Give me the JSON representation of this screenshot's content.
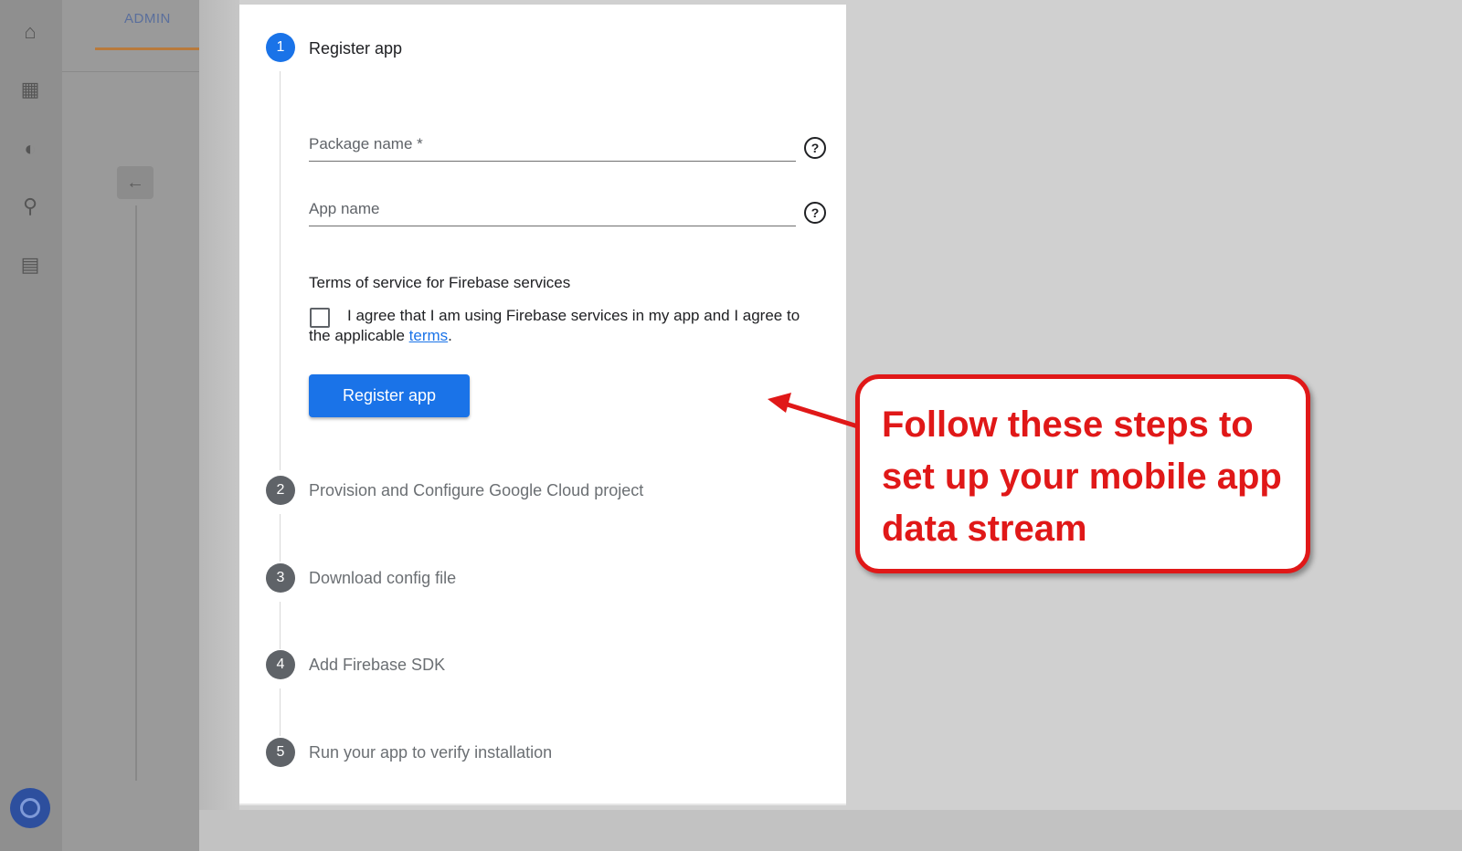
{
  "background_app": {
    "admin_tab_label": "ADMIN"
  },
  "steps": [
    {
      "number": "1",
      "title": "Register app",
      "state": "active"
    },
    {
      "number": "2",
      "title": "Provision and Configure Google Cloud project",
      "state": "inactive"
    },
    {
      "number": "3",
      "title": "Download config file",
      "state": "inactive"
    },
    {
      "number": "4",
      "title": "Add Firebase SDK",
      "state": "inactive"
    },
    {
      "number": "5",
      "title": "Run your app to verify installation",
      "state": "inactive"
    }
  ],
  "form": {
    "package_name_placeholder": "Package name *",
    "package_name_value": "",
    "app_name_placeholder": "App name",
    "app_name_value": "",
    "help_icon_glyph": "?",
    "terms_heading": "Terms of service for Firebase services",
    "agree_text_before": "I agree that I am using Firebase services in my app and I agree to the applicable ",
    "agree_link": "terms",
    "agree_text_after": ".",
    "checkbox_checked": false,
    "register_button_label": "Register app"
  },
  "annotation": {
    "callout_text": "Follow these steps to set up your mobile app data stream",
    "color": "#e01818"
  },
  "colors": {
    "primary": "#1a73e8",
    "inactive_step": "#5f6368"
  },
  "icons": {
    "rail": [
      "home-icon",
      "reports-icon",
      "explore-icon",
      "advertising-icon",
      "library-icon",
      "settings-icon"
    ],
    "help": "help-circle-icon",
    "back": "arrow-left-icon"
  }
}
